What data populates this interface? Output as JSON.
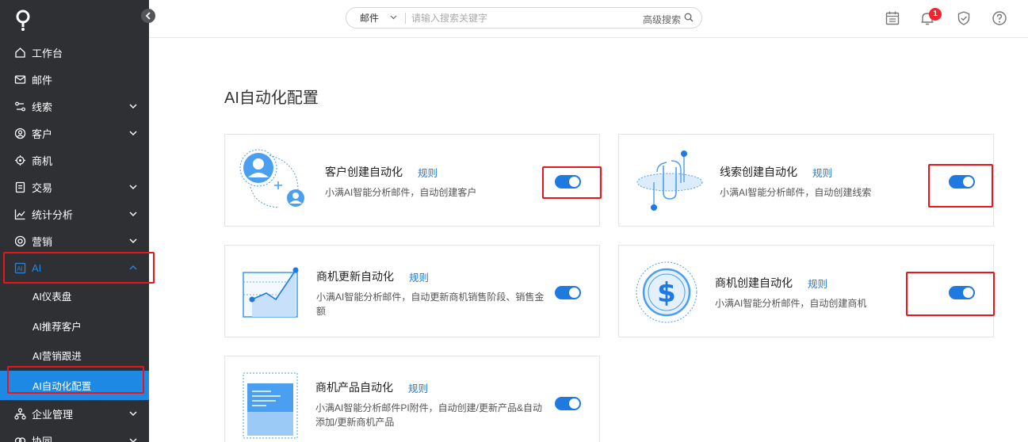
{
  "sidebar": {
    "items": [
      {
        "label": "工作台"
      },
      {
        "label": "邮件"
      },
      {
        "label": "线索"
      },
      {
        "label": "客户"
      },
      {
        "label": "商机"
      },
      {
        "label": "交易"
      },
      {
        "label": "统计分析"
      },
      {
        "label": "营销"
      },
      {
        "label": "AI"
      },
      {
        "label": "企业管理"
      },
      {
        "label": "协同"
      }
    ],
    "ai_submenu": [
      {
        "label": "AI仪表盘"
      },
      {
        "label": "AI推荐客户"
      },
      {
        "label": "AI营销跟进"
      },
      {
        "label": "AI自动化配置"
      }
    ]
  },
  "topbar": {
    "search_scope": "邮件",
    "search_placeholder": "请输入搜索关键字",
    "advanced_search": "高级搜索",
    "notification_count": "1"
  },
  "main": {
    "title": "AI自动化配置",
    "cards": [
      {
        "title": "客户创建自动化",
        "rule": "规则",
        "desc": "小满AI智能分析邮件，自动创建客户",
        "enabled": true
      },
      {
        "title": "线索创建自动化",
        "rule": "规则",
        "desc": "小满AI智能分析邮件，自动创建线索",
        "enabled": true
      },
      {
        "title": "商机更新自动化",
        "rule": "规则",
        "desc_line1": "小满AI智能分析邮件，自动更新商机销售阶段、销售金",
        "desc_line2": "额",
        "enabled": true
      },
      {
        "title": "商机创建自动化",
        "rule": "规则",
        "desc": "小满AI智能分析邮件，自动创建商机",
        "enabled": true
      },
      {
        "title": "商机产品自动化",
        "rule": "规则",
        "desc_line1": "小满AI智能分析邮件PI附件，自动创建/更新产品&自动",
        "desc_line2": "添加/更新商机产品",
        "enabled": true
      }
    ]
  },
  "colors": {
    "sidebar_bg": "#2f3033",
    "accent": "#1e7ae0",
    "highlight": "#e8161c"
  }
}
